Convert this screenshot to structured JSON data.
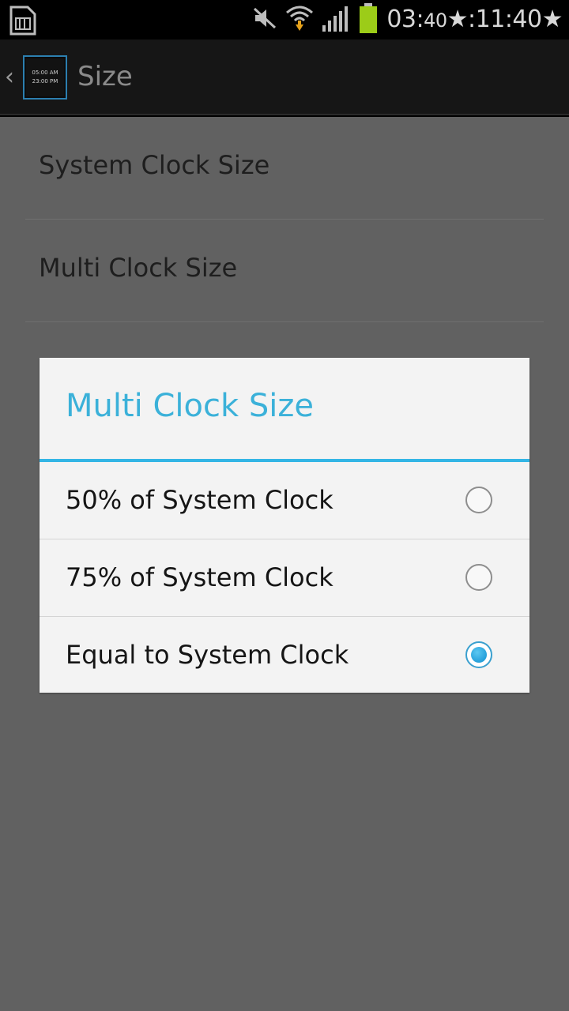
{
  "status_bar": {
    "time_hours": "03:",
    "time_small": "40",
    "time_rest": "★:11:40★",
    "icons": [
      "sim-card-icon",
      "mute-icon",
      "wifi-icon",
      "signal-icon",
      "battery-icon"
    ],
    "battery_color": "#9ccc18"
  },
  "action_bar": {
    "back_glyph": "‹",
    "app_icon_lines": [
      "05:00 AM",
      "23:00 PM"
    ],
    "title": "Size"
  },
  "settings": {
    "items": [
      {
        "label": "System Clock Size"
      },
      {
        "label": "Multi Clock Size"
      }
    ]
  },
  "dialog": {
    "title": "Multi Clock Size",
    "options": [
      {
        "label": "50% of System Clock",
        "checked": false
      },
      {
        "label": "75% of System Clock",
        "checked": false
      },
      {
        "label": "Equal to System Clock",
        "checked": true
      }
    ],
    "accent_color": "#33b5e5"
  }
}
